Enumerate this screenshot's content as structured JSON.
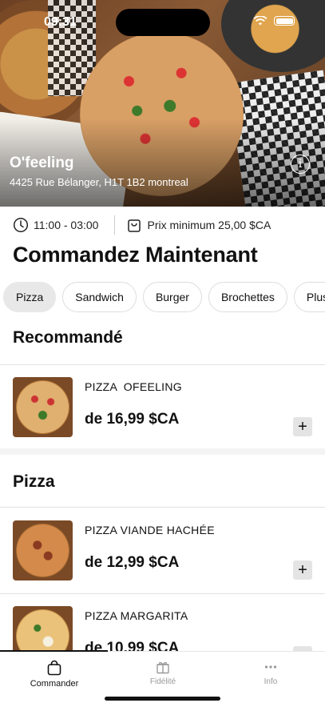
{
  "status_bar": {
    "time": "09:31"
  },
  "restaurant": {
    "name": "O'feeling",
    "address": "4425 Rue Bélanger, H1T 1B2 montreal"
  },
  "info_row": {
    "hours": "11:00 - 03:00",
    "min_price": "Prix minimum 25,00 $CA"
  },
  "page_title": "Commandez Maintenant",
  "categories": [
    {
      "label": "Pizza",
      "active": true
    },
    {
      "label": "Sandwich",
      "active": false
    },
    {
      "label": "Burger",
      "active": false
    },
    {
      "label": "Brochettes",
      "active": false
    },
    {
      "label": "Plus",
      "active": false
    }
  ],
  "sections": [
    {
      "title": "Recommandé",
      "items": [
        {
          "name": "PIZZA  OFEELING",
          "price": "de 16,99 $CA",
          "add_label": "+"
        }
      ]
    },
    {
      "title": "Pizza",
      "items": [
        {
          "name": "PIZZA VIANDE HACHÉE",
          "price": "de 12,99 $CA",
          "add_label": "+"
        },
        {
          "name": "PIZZA MARGARITA",
          "price": "de 10,99 $CA",
          "add_label": "+"
        }
      ]
    }
  ],
  "tabbar": {
    "tabs": [
      {
        "label": "Commander",
        "icon": "bag-icon",
        "active": true
      },
      {
        "label": "Fidélité",
        "icon": "gift-icon",
        "active": false
      },
      {
        "label": "Info",
        "icon": "ellipsis-icon",
        "active": false
      }
    ]
  },
  "colors": {
    "accent": "#111111",
    "chip_active_bg": "#e8e8e8",
    "add_button_bg": "#e4e4e4"
  }
}
